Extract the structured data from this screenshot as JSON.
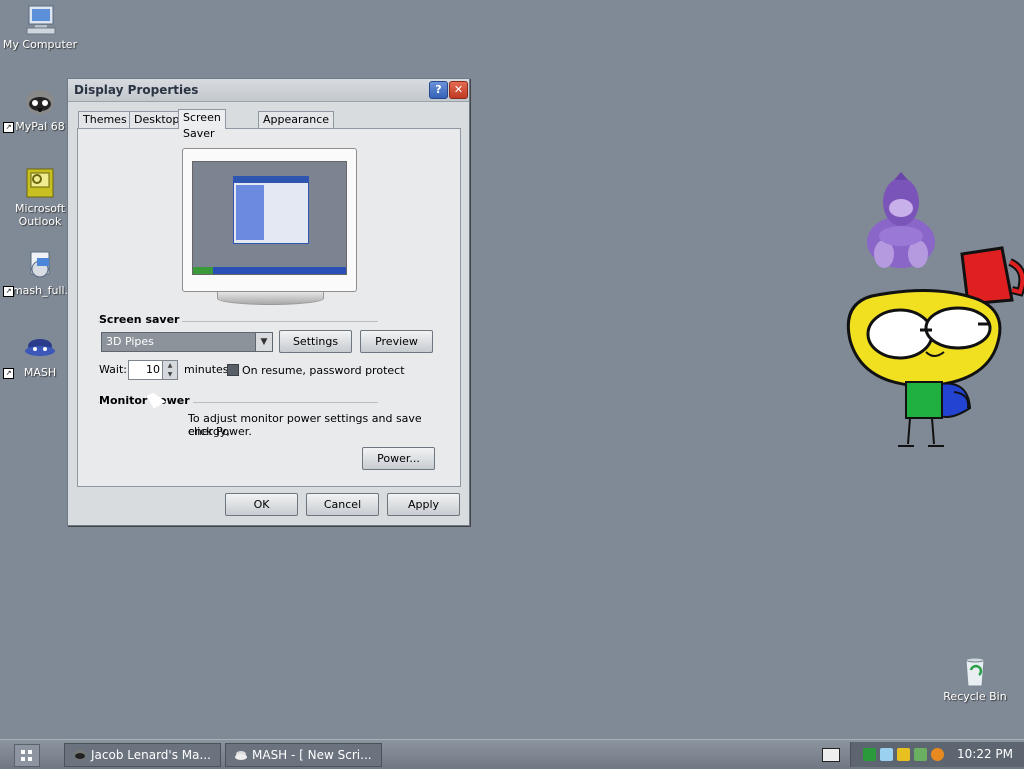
{
  "desktop": {
    "icons": [
      {
        "label": "My Computer",
        "icon": "computer-icon"
      },
      {
        "label": "MyPal 68",
        "icon": "mypal-raccoon-icon"
      },
      {
        "label": "Microsoft Outlook",
        "icon": "outlook-icon"
      },
      {
        "label": "mash_full.",
        "icon": "installer-icon"
      },
      {
        "label": "MASH",
        "icon": "mash-icon"
      },
      {
        "label": "Recycle Bin",
        "icon": "recycle-bin-icon"
      }
    ]
  },
  "window": {
    "title": "Display Properties",
    "help_glyph": "?",
    "close_glyph": "✕",
    "tabs": [
      "Themes",
      "Desktop",
      "Screen Saver",
      "Appearance"
    ],
    "active_tab": "Screen Saver",
    "screen_saver": {
      "group_label": "Screen saver",
      "selected": "3D Pipes",
      "settings_label": "Settings",
      "preview_label": "Preview",
      "wait_label": "Wait:",
      "wait_value": "10",
      "minutes_label": "minutes",
      "password_label": "On resume, password protect",
      "password_checked": false
    },
    "monitor_power": {
      "group_label": "Monitor power",
      "description_line1": "To adjust monitor power settings and save energy,",
      "description_line2": "click Power.",
      "power_label": "Power..."
    },
    "buttons": {
      "ok": "OK",
      "cancel": "Cancel",
      "apply": "Apply"
    }
  },
  "taskbar": {
    "tasks": [
      "Jacob Lenard's Ma...",
      "MASH - [ New Scri..."
    ],
    "clock": "10:22 PM"
  },
  "colors": {
    "desktop": "#808a96",
    "window_face": "#d9dcdf",
    "dropdown_selected": "#8c939b"
  }
}
